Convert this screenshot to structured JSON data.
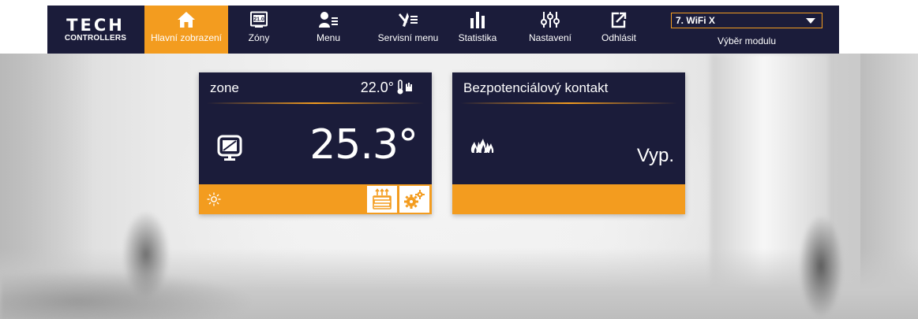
{
  "brand": {
    "logo_top": "TECH",
    "logo_bottom": "CONTROLLERS"
  },
  "nav": {
    "items": [
      {
        "label": "Hlavní zobrazení",
        "icon": "home-icon",
        "active": true
      },
      {
        "label": "Zóny",
        "icon": "zones-icon",
        "badge": "21.0"
      },
      {
        "label": "Menu",
        "icon": "user-menu-icon"
      },
      {
        "label": "Servisní menu",
        "icon": "tools-icon"
      },
      {
        "label": "Statistika",
        "icon": "bar-chart-icon"
      },
      {
        "label": "Nastavení",
        "icon": "sliders-icon"
      },
      {
        "label": "Odhlásit",
        "icon": "logout-icon"
      }
    ],
    "module_select": {
      "value": "7. WiFi X",
      "label": "Výběr modulu"
    }
  },
  "tiles": {
    "zone": {
      "name": "zone",
      "set_temp": "22.0°",
      "current_temp": "25.3°",
      "accent": "#f39c1f"
    },
    "relay": {
      "title": "Bezpotenciálový kontakt",
      "state": "Vyp."
    }
  },
  "colors": {
    "navy": "#1b1c3a",
    "orange": "#f39c1f"
  }
}
